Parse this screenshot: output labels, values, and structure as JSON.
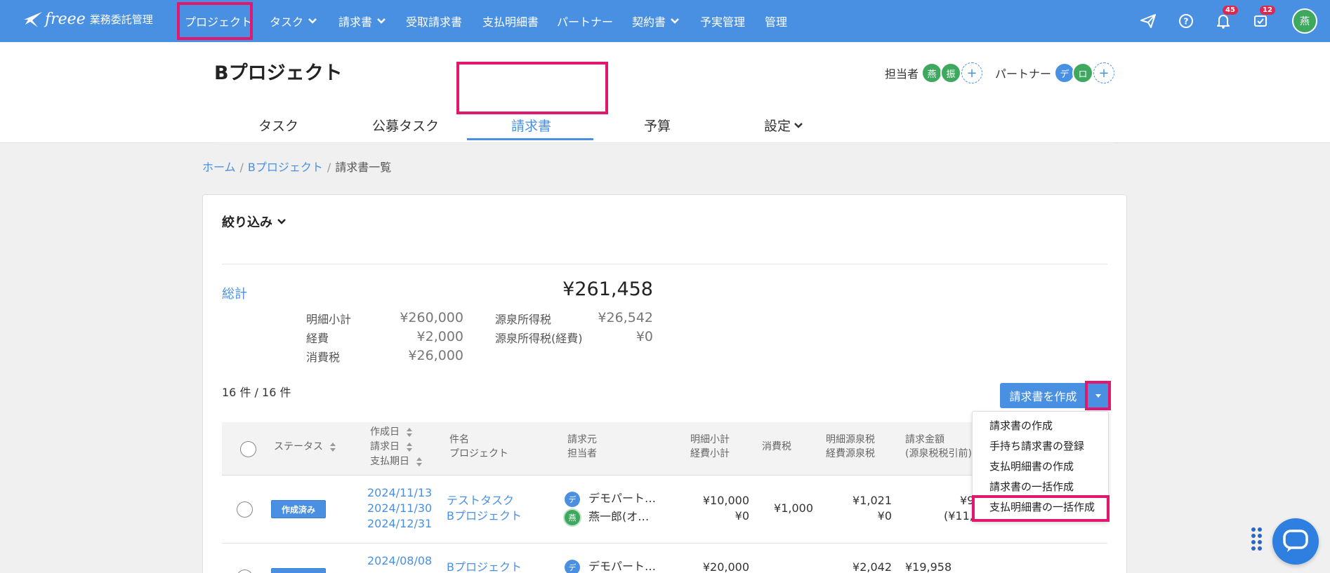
{
  "app": {
    "brand": "freee",
    "product": "業務委託管理"
  },
  "topnav": {
    "items": [
      {
        "label": "プロジェクト",
        "has_dropdown": false,
        "active": true
      },
      {
        "label": "タスク",
        "has_dropdown": true
      },
      {
        "label": "請求書",
        "has_dropdown": true
      },
      {
        "label": "受取請求書",
        "has_dropdown": false
      },
      {
        "label": "支払明細書",
        "has_dropdown": false
      },
      {
        "label": "パートナー",
        "has_dropdown": false
      },
      {
        "label": "契約書",
        "has_dropdown": true
      },
      {
        "label": "予実管理",
        "has_dropdown": false
      },
      {
        "label": "管理",
        "has_dropdown": false
      }
    ],
    "icons": [
      "send-icon",
      "help-icon",
      "bell-icon",
      "inbox-icon"
    ],
    "notification_count": "45",
    "inbox_count": "12",
    "user_initial": "燕"
  },
  "project": {
    "title": "Bプロジェクト",
    "assignee_label": "担当者",
    "assignees": [
      "燕",
      "振"
    ],
    "partner_label": "パートナー",
    "partners": [
      "デ",
      "ロ"
    ],
    "add_symbol": "+"
  },
  "tabs": [
    {
      "label": "タスク"
    },
    {
      "label": "公募タスク"
    },
    {
      "label": "請求書",
      "active": true
    },
    {
      "label": "予算"
    },
    {
      "label": "設定",
      "has_dropdown": true
    }
  ],
  "breadcrumb": {
    "home": "ホーム",
    "project": "Bプロジェクト",
    "current": "請求書一覧",
    "separator": "/"
  },
  "filter": {
    "label": "絞り込み"
  },
  "summary": {
    "total_label": "総計",
    "total_value": "¥261,458",
    "left": [
      {
        "label": "明細小計",
        "value": "¥260,000"
      },
      {
        "label": "経費",
        "value": "¥2,000"
      },
      {
        "label": "消費税",
        "value": "¥26,000"
      }
    ],
    "right": [
      {
        "label": "源泉所得税",
        "value": "¥26,542"
      },
      {
        "label": "源泉所得税(経費)",
        "value": "¥0"
      }
    ]
  },
  "count_text": "16 件 / 16 件",
  "create_button": {
    "label": "請求書を作成"
  },
  "dropdown_menu": [
    "請求書の作成",
    "手持ち請求書の登録",
    "支払明細書の作成",
    "請求書の一括作成",
    "支払明細書の一括作成"
  ],
  "table": {
    "headers": {
      "status": "ステータス",
      "created": "作成日",
      "billed": "請求日",
      "due": "支払期日",
      "subject": "件名",
      "project": "プロジェクト",
      "issuer": "請求元",
      "assignee": "担当者",
      "subtotal": "明細小計",
      "expense_subtotal": "経費小計",
      "tax": "消費税",
      "withholding": "明細源泉税",
      "expense_withholding": "経費源泉税",
      "amount": "請求金額",
      "amount_note": "(源泉税税引前)"
    },
    "rows": [
      {
        "status": "作成済み",
        "created": "2024/11/13",
        "billed": "2024/11/30",
        "due": "2024/12/31",
        "subject": "テストタスク",
        "project": "Bプロジェクト",
        "issuer_initial": "デ",
        "issuer": "デモパート…",
        "assignee_initial": "燕",
        "assignee": "燕一郎(オ…",
        "subtotal": "¥10,000",
        "expense_subtotal": "¥0",
        "tax": "¥1,000",
        "withholding": "¥1,021",
        "expense_withholding": "¥0",
        "amount": "¥9",
        "amount_gross": "(¥11,"
      },
      {
        "status": "",
        "created": "2024/08/08",
        "billed": "",
        "due": "",
        "subject": "",
        "project": "Bプロジェクト",
        "issuer_initial": "デ",
        "issuer": "デモパート…",
        "subtotal": "¥20,000",
        "tax": "",
        "withholding": "¥2,042",
        "amount": "¥19,958"
      }
    ]
  },
  "colors": {
    "nav_bg": "#4a90e2",
    "accent": "#4a90e2",
    "highlight": "#e2186f",
    "avatar_green": "#3fa85f",
    "avatar_blue": "#4a90e2"
  }
}
